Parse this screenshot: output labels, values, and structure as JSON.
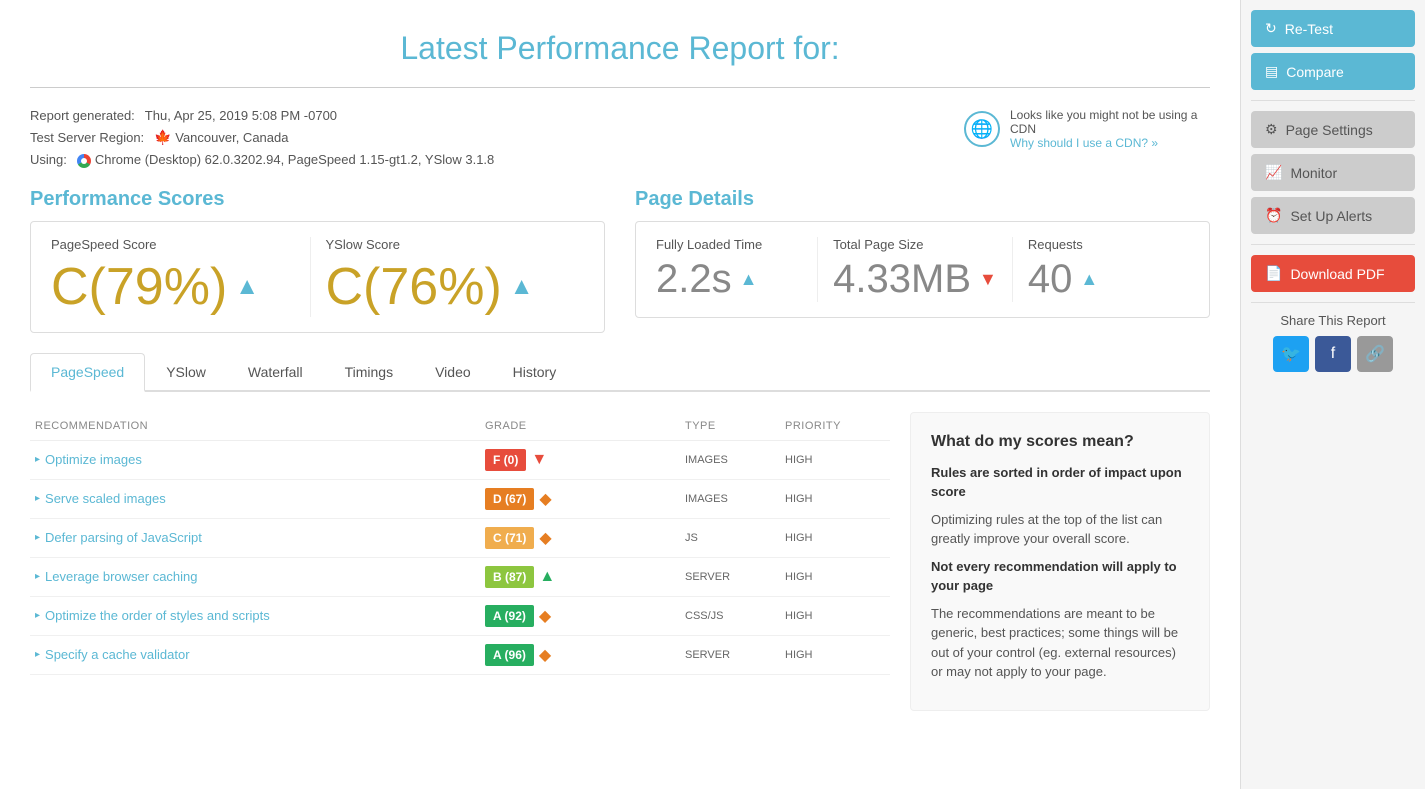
{
  "header": {
    "title": "Latest Performance Report for:"
  },
  "report": {
    "generated_label": "Report generated:",
    "generated_value": "Thu, Apr 25, 2019 5:08 PM -0700",
    "server_label": "Test Server Region:",
    "server_value": "Vancouver, Canada",
    "using_label": "Using:",
    "using_value": "Chrome (Desktop) 62.0.3202.94, PageSpeed 1.15-gt1.2, YSlow 3.1.8",
    "cdn_text": "Looks like you might not be using a CDN",
    "cdn_link": "Why should I use a CDN? »"
  },
  "performance_scores": {
    "title": "Performance Scores",
    "pagespeed": {
      "label": "PageSpeed Score",
      "value": "C(79%)"
    },
    "yslow": {
      "label": "YSlow Score",
      "value": "C(76%)"
    }
  },
  "page_details": {
    "title": "Page Details",
    "loaded_time": {
      "label": "Fully Loaded Time",
      "value": "2.2s",
      "arrow": "up"
    },
    "page_size": {
      "label": "Total Page Size",
      "value": "4.33MB",
      "arrow": "down"
    },
    "requests": {
      "label": "Requests",
      "value": "40",
      "arrow": "up"
    }
  },
  "tabs": [
    {
      "id": "pagespeed",
      "label": "PageSpeed",
      "active": true
    },
    {
      "id": "yslow",
      "label": "YSlow",
      "active": false
    },
    {
      "id": "waterfall",
      "label": "Waterfall",
      "active": false
    },
    {
      "id": "timings",
      "label": "Timings",
      "active": false
    },
    {
      "id": "video",
      "label": "Video",
      "active": false
    },
    {
      "id": "history",
      "label": "History",
      "active": false
    }
  ],
  "table": {
    "headers": [
      "RECOMMENDATION",
      "GRADE",
      "TYPE",
      "PRIORITY"
    ],
    "rows": [
      {
        "name": "Optimize images",
        "grade": "F (0)",
        "grade_class": "grade-f",
        "icon": "▼",
        "icon_class": "icon-red",
        "type": "IMAGES",
        "priority": "HIGH"
      },
      {
        "name": "Serve scaled images",
        "grade": "D (67)",
        "grade_class": "grade-d",
        "icon": "◆",
        "icon_class": "icon-orange",
        "type": "IMAGES",
        "priority": "HIGH"
      },
      {
        "name": "Defer parsing of JavaScript",
        "grade": "C (71)",
        "grade_class": "grade-c",
        "icon": "◆",
        "icon_class": "icon-orange",
        "type": "JS",
        "priority": "HIGH"
      },
      {
        "name": "Leverage browser caching",
        "grade": "B (87)",
        "grade_class": "grade-b",
        "icon": "▲",
        "icon_class": "icon-green",
        "type": "SERVER",
        "priority": "HIGH"
      },
      {
        "name": "Optimize the order of styles and scripts",
        "grade": "A (92)",
        "grade_class": "grade-a",
        "icon": "◆",
        "icon_class": "icon-orange",
        "type": "CSS/JS",
        "priority": "HIGH"
      },
      {
        "name": "Specify a cache validator",
        "grade": "A (96)",
        "grade_class": "grade-a",
        "icon": "◆",
        "icon_class": "icon-orange",
        "type": "SERVER",
        "priority": "HIGH"
      }
    ]
  },
  "info_box": {
    "title": "What do my scores mean?",
    "section1_title": "Rules are sorted in order of impact upon score",
    "section1_text": "Optimizing rules at the top of the list can greatly improve your overall score.",
    "section2_title": "Not every recommendation will apply to your page",
    "section2_text": "The recommendations are meant to be generic, best practices; some things will be out of your control (eg. external resources) or may not apply to your page."
  },
  "sidebar": {
    "retest_label": "Re-Test",
    "compare_label": "Compare",
    "page_settings_label": "Page Settings",
    "monitor_label": "Monitor",
    "setup_alerts_label": "Set Up Alerts",
    "download_pdf_label": "Download PDF",
    "share_title": "Share This Report"
  }
}
